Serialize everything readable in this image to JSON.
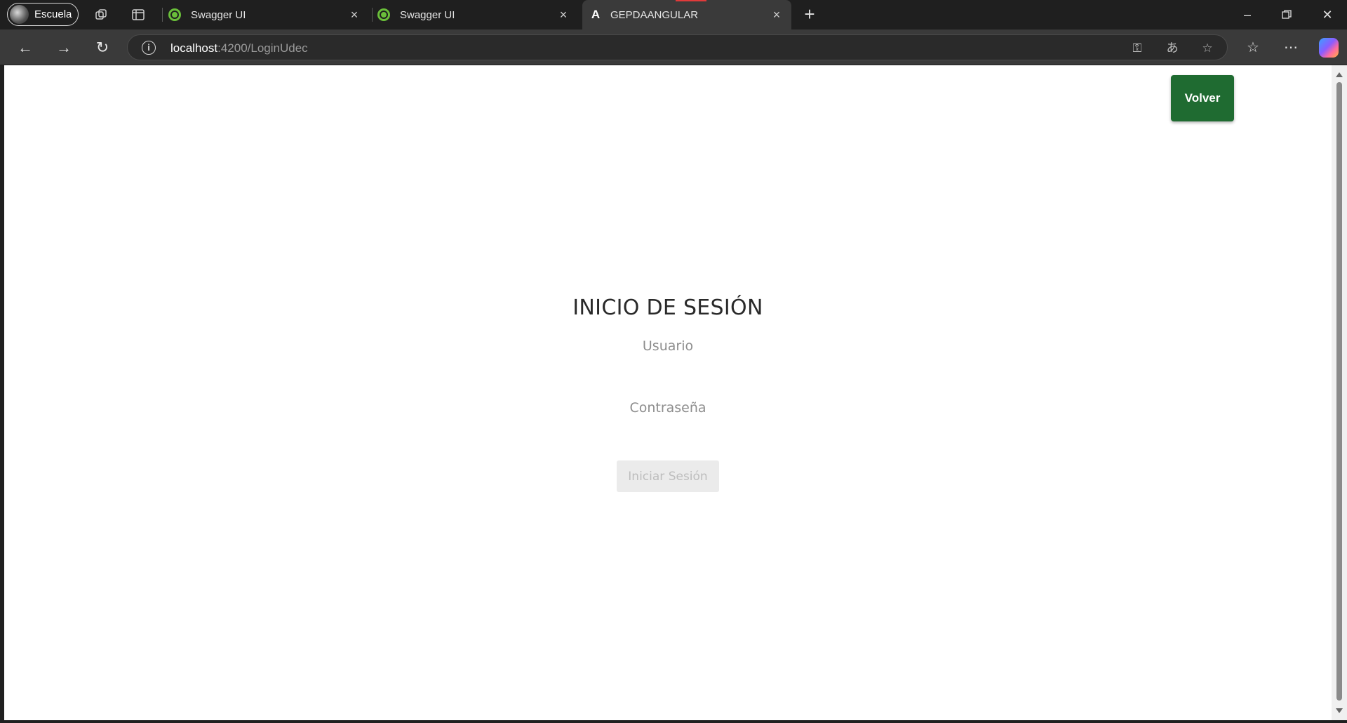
{
  "browser": {
    "profile_label": "Escuela",
    "tabs": [
      {
        "title": "Swagger UI"
      },
      {
        "title": "Swagger UI"
      },
      {
        "title": "GEPDAANGULAR"
      }
    ],
    "url_host": "localhost",
    "url_rest": ":4200/LoginUdec"
  },
  "page": {
    "back_button": "Volver",
    "title": "INICIO DE SESIÓN",
    "username_placeholder": "Usuario",
    "password_placeholder": "Contraseña",
    "submit_label": "Iniciar Sesión"
  },
  "colors": {
    "back_button_bg": "#1f6b31",
    "disabled_button_bg": "#ebebeb"
  }
}
